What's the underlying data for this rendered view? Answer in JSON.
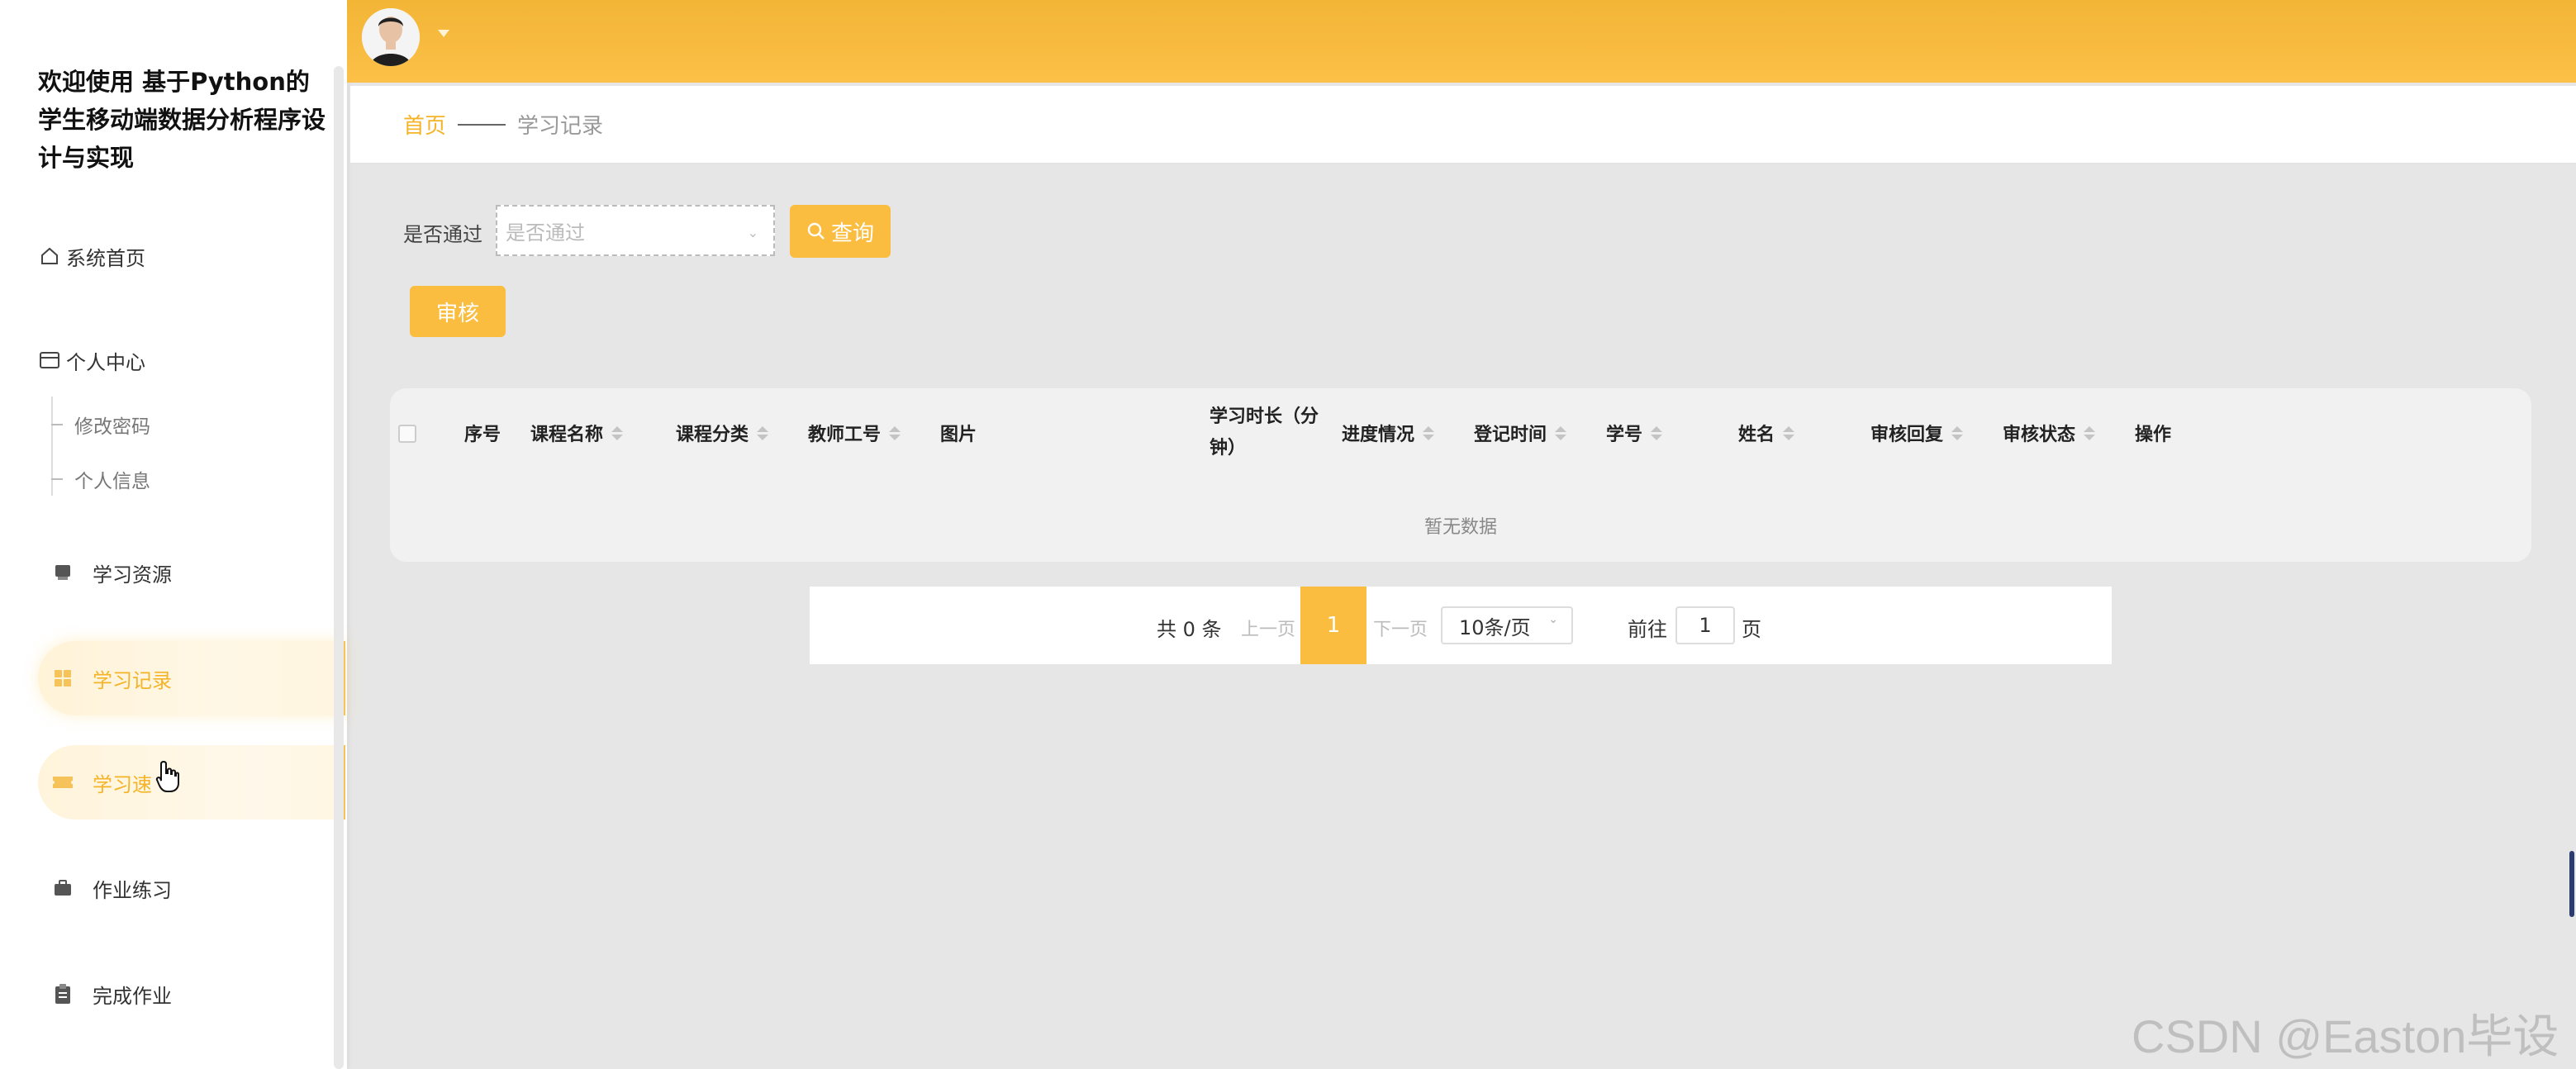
{
  "app": {
    "title": "欢迎使用 基于Python的学生移动端数据分析程序设计与实现"
  },
  "sidebar": {
    "items": [
      {
        "label": "系统首页",
        "icon": "home-icon"
      },
      {
        "label": "个人中心",
        "icon": "card-icon",
        "children": [
          "修改密码",
          "个人信息"
        ]
      },
      {
        "label": "学习资源",
        "icon": "book-icon"
      },
      {
        "label": "学习记录",
        "icon": "grid-icon",
        "active": true
      },
      {
        "label": "学习速",
        "icon": "ticket-icon"
      },
      {
        "label": "作业练习",
        "icon": "briefcase-icon"
      },
      {
        "label": "完成作业",
        "icon": "clipboard-icon"
      }
    ]
  },
  "breadcrumb": {
    "home": "首页",
    "current": "学习记录"
  },
  "filters": {
    "pass_label": "是否通过",
    "pass_placeholder": "是否通过",
    "search_label": "查询",
    "review_label": "审核"
  },
  "table": {
    "columns": [
      "序号",
      "课程名称",
      "课程分类",
      "教师工号",
      "图片",
      "学习时长（分钟）",
      "进度情况",
      "登记时间",
      "学号",
      "姓名",
      "审核回复",
      "审核状态",
      "操作"
    ],
    "col_duration_line1": "学习时长（分",
    "col_duration_line2": "钟）",
    "empty_text": "暂无数据"
  },
  "pagination": {
    "total": "共 0 条",
    "prev": "上一页",
    "current_page": "1",
    "next": "下一页",
    "page_size": "10条/页",
    "goto_label": "前往",
    "goto_value": "1",
    "goto_unit": "页"
  },
  "watermark": "CSDN @Easton毕设",
  "colors": {
    "accent": "#fbbd3f",
    "header": "#f2b536",
    "active_text": "#f5b428"
  }
}
